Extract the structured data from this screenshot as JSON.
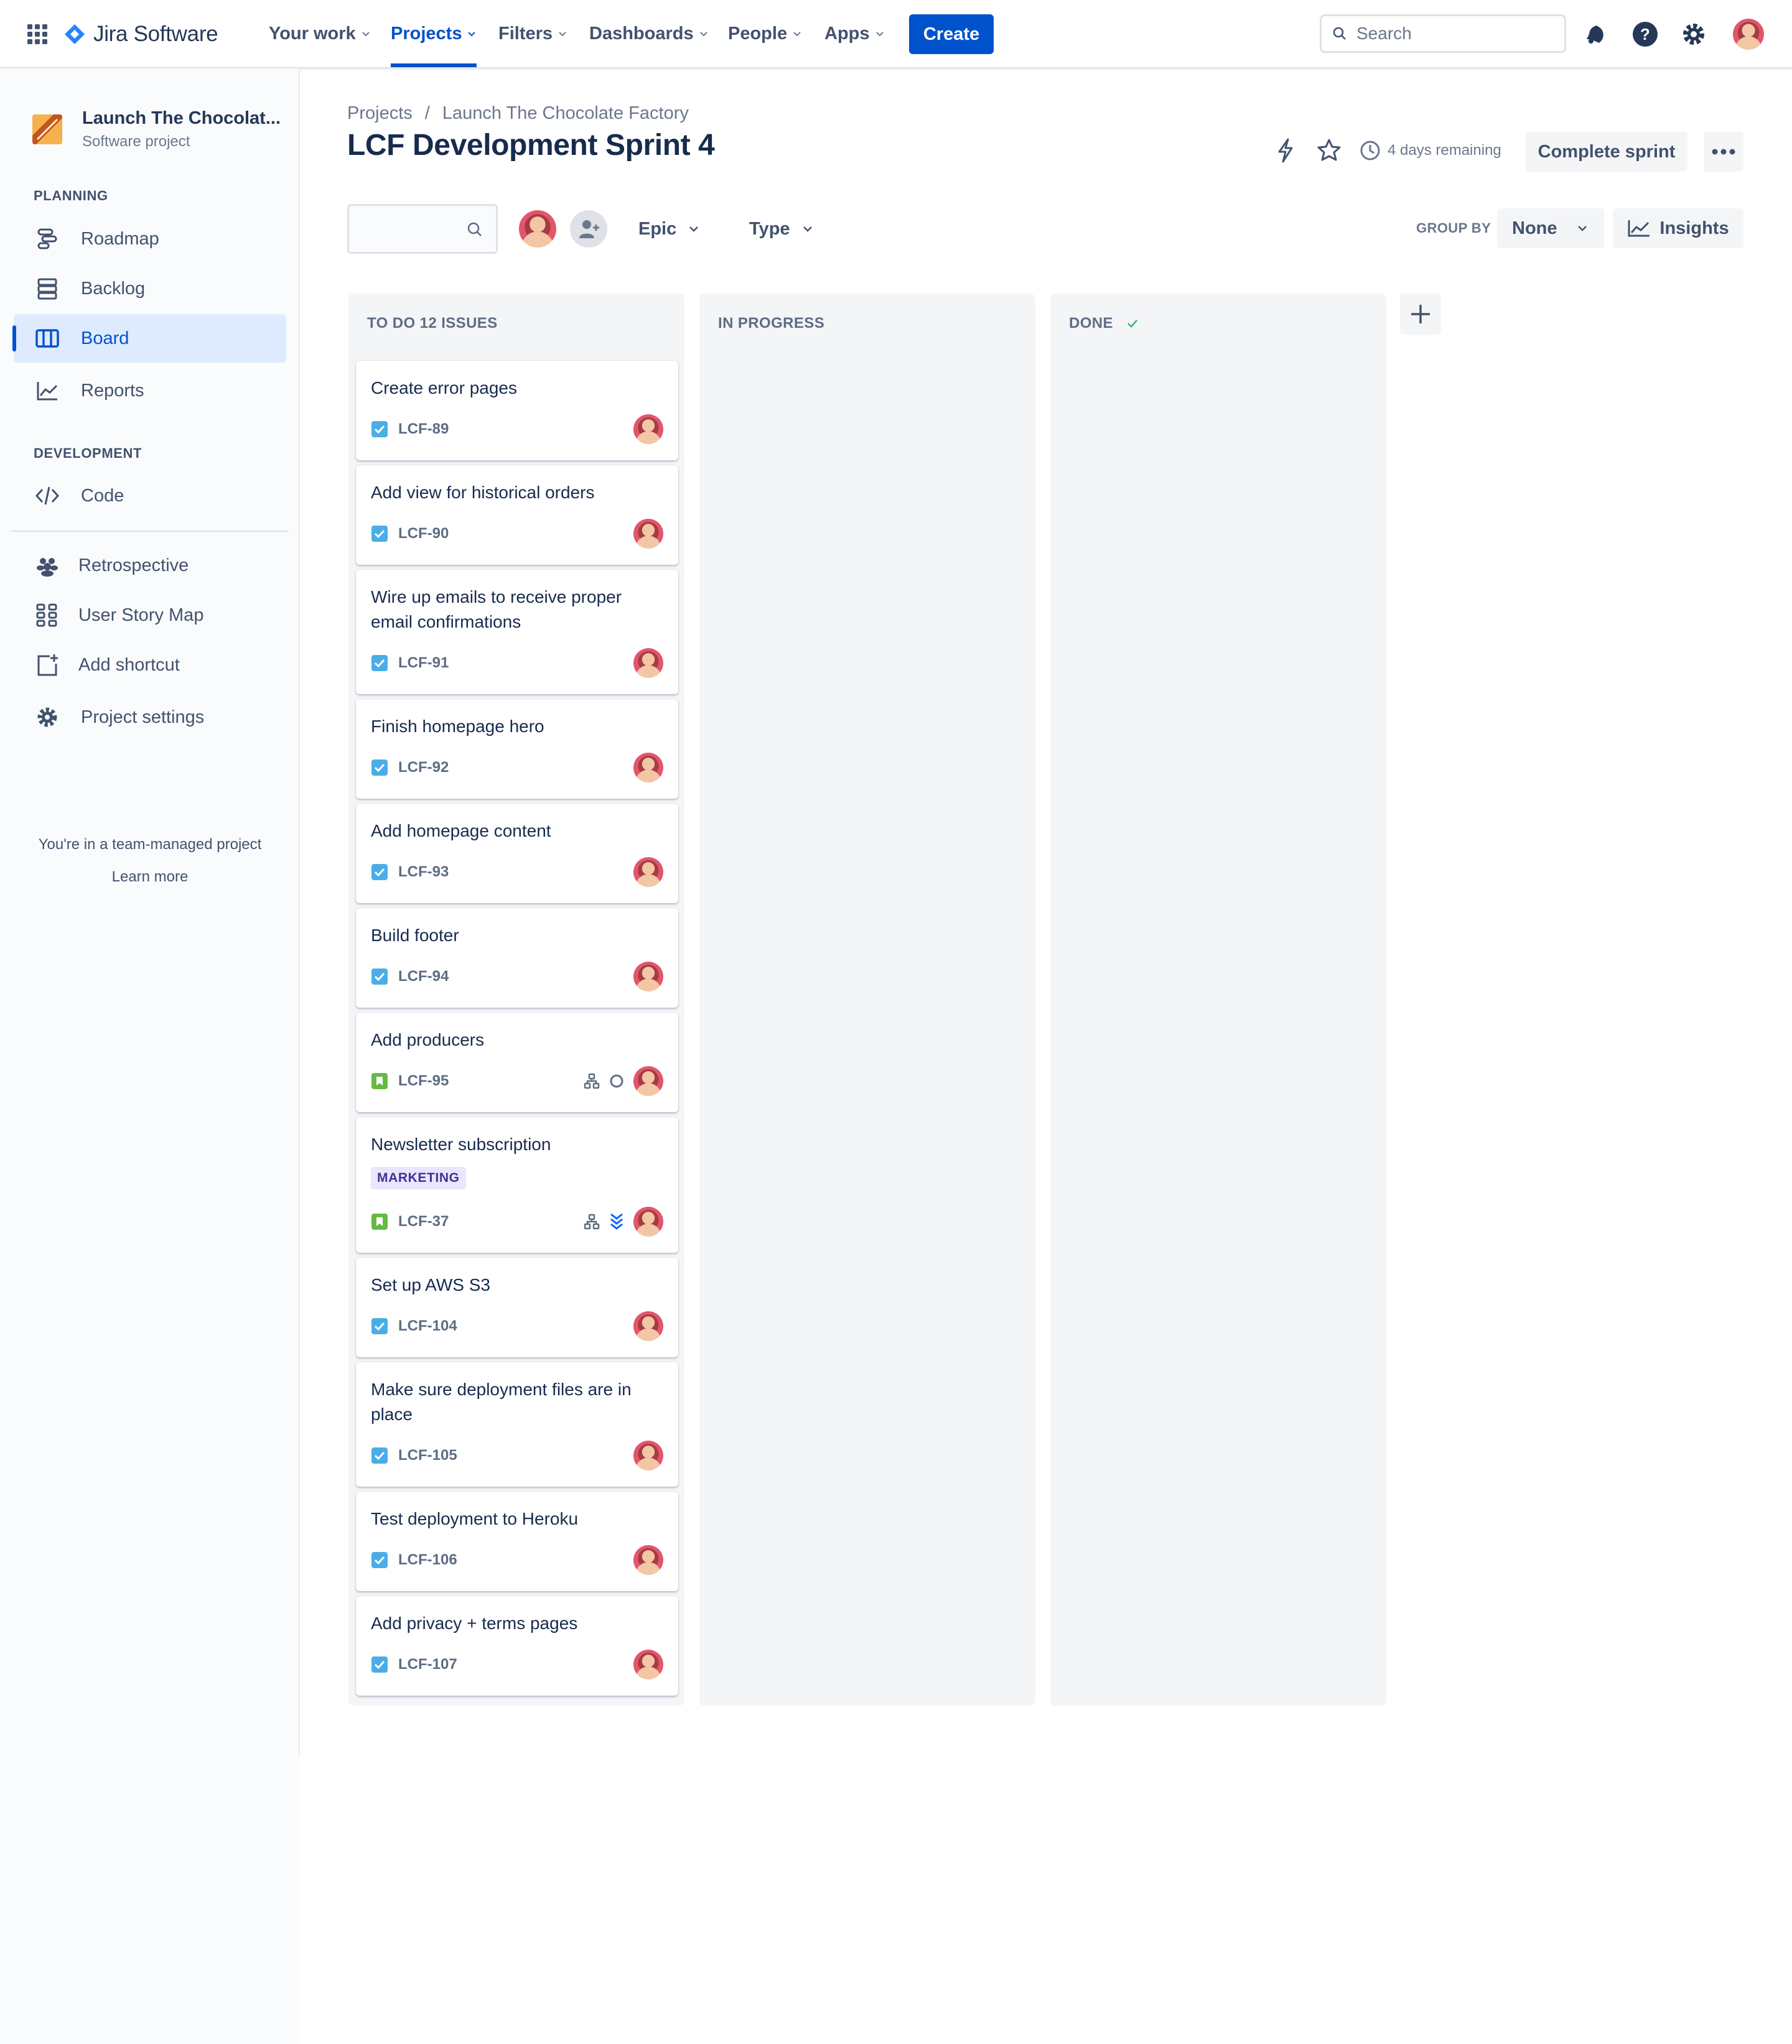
{
  "topnav": {
    "product": "Jira Software",
    "items": [
      {
        "label": "Your work",
        "active": false
      },
      {
        "label": "Projects",
        "active": true
      },
      {
        "label": "Filters",
        "active": false
      },
      {
        "label": "Dashboards",
        "active": false
      },
      {
        "label": "People",
        "active": false
      },
      {
        "label": "Apps",
        "active": false
      }
    ],
    "create_label": "Create",
    "search_placeholder": "Search"
  },
  "sidebar": {
    "project_name": "Launch The Chocolat...",
    "project_type": "Software project",
    "planning_label": "PLANNING",
    "development_label": "DEVELOPMENT",
    "items": {
      "roadmap": "Roadmap",
      "backlog": "Backlog",
      "board": "Board",
      "reports": "Reports",
      "code": "Code",
      "retrospective": "Retrospective",
      "user_story_map": "User Story Map",
      "add_shortcut": "Add shortcut",
      "project_settings": "Project settings"
    },
    "active_item": "board",
    "footer_text": "You're in a team-managed project",
    "learn_more": "Learn more"
  },
  "header": {
    "breadcrumb": [
      "Projects",
      "Launch The Chocolate Factory"
    ],
    "breadcrumb_separator": "/",
    "title": "LCF Development Sprint 4",
    "remaining": "4 days remaining",
    "complete_sprint": "Complete sprint"
  },
  "toolbar": {
    "epic_label": "Epic",
    "type_label": "Type",
    "group_by_label": "GROUP BY",
    "group_by_value": "None",
    "insights_label": "Insights"
  },
  "board": {
    "columns": [
      {
        "title": "TO DO 12 ISSUES"
      },
      {
        "title": "IN PROGRESS"
      },
      {
        "title": "DONE"
      }
    ],
    "cards": [
      {
        "title": "Create error pages",
        "key": "LCF-89",
        "type": "task"
      },
      {
        "title": "Add view for historical orders",
        "key": "LCF-90",
        "type": "task"
      },
      {
        "title": "Wire up emails to receive proper email confirmations",
        "key": "LCF-91",
        "type": "task"
      },
      {
        "title": "Finish homepage hero",
        "key": "LCF-92",
        "type": "task"
      },
      {
        "title": "Add homepage content",
        "key": "LCF-93",
        "type": "task"
      },
      {
        "title": "Build footer",
        "key": "LCF-94",
        "type": "task"
      },
      {
        "title": "Add producers",
        "key": "LCF-95",
        "type": "story",
        "icons": [
          "child-issues-icon",
          "status-circle-icon"
        ]
      },
      {
        "title": "Newsletter subscription",
        "key": "LCF-37",
        "type": "story",
        "label": "MARKETING",
        "icons": [
          "child-issues-icon",
          "priority-lowest-icon"
        ]
      },
      {
        "title": "Set up AWS S3",
        "key": "LCF-104",
        "type": "task"
      },
      {
        "title": "Make sure deployment files are in place",
        "key": "LCF-105",
        "type": "task"
      },
      {
        "title": "Test deployment to Heroku",
        "key": "LCF-106",
        "type": "task"
      },
      {
        "title": "Add privacy + terms pages",
        "key": "LCF-107",
        "type": "task"
      }
    ]
  },
  "colors": {
    "brand": "#0052cc",
    "task": "#4bade8",
    "story": "#65ba43",
    "done_check": "#36b37e",
    "label_bg": "#eae6ff",
    "label_text": "#403294"
  }
}
